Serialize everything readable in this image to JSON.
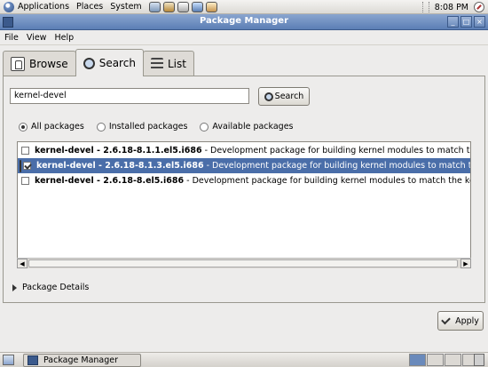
{
  "top_panel": {
    "menus": [
      "Applications",
      "Places",
      "System"
    ],
    "launchers": [
      "browser-icon",
      "email-icon",
      "notes-icon",
      "text-editor-icon",
      "network-icon"
    ],
    "clock": "8:08 PM"
  },
  "window": {
    "title": "Package Manager",
    "controls": [
      "minimize",
      "maximize",
      "close"
    ]
  },
  "menubar": [
    "File",
    "View",
    "Help"
  ],
  "tabs": [
    {
      "label": "Browse",
      "icon": "browse-icon",
      "active": false
    },
    {
      "label": "Search",
      "icon": "search-icon",
      "active": true
    },
    {
      "label": "List",
      "icon": "list-icon",
      "active": false
    }
  ],
  "search": {
    "value": "kernel-devel",
    "button_label": "Search"
  },
  "filters": [
    {
      "label": "All packages",
      "selected": true
    },
    {
      "label": "Installed packages",
      "selected": false
    },
    {
      "label": "Available packages",
      "selected": false
    }
  ],
  "packages": [
    {
      "name": "kernel-devel - 2.6.18-8.1.1.el5.i686",
      "desc": " - Development package for building kernel modules to match the kernel",
      "checked": false,
      "selected": false
    },
    {
      "name": "kernel-devel - 2.6.18-8.1.3.el5.i686",
      "desc": " - Development package for building kernel modules to match the kernel",
      "checked": true,
      "selected": true
    },
    {
      "name": "kernel-devel - 2.6.18-8.el5.i686",
      "desc": " - Development package for building kernel modules to match the kernel",
      "checked": false,
      "selected": false
    }
  ],
  "details_label": "Package Details",
  "apply_label": "Apply",
  "taskbar": {
    "task_label": "Package Manager",
    "workspaces": 4,
    "active_workspace": 1
  },
  "colors": {
    "selection": "#4a6ea9",
    "titlebar": "#5b7eb5"
  }
}
